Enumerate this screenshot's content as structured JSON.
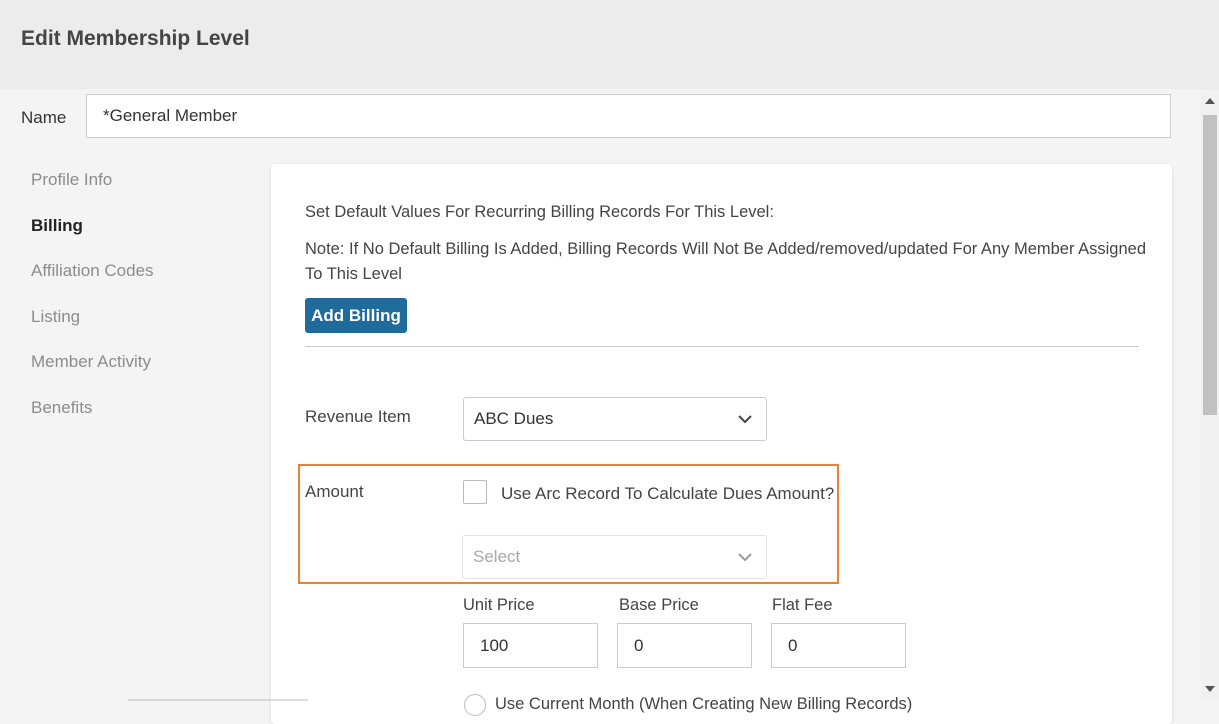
{
  "header": {
    "title": "Edit Membership Level"
  },
  "name_field": {
    "label": "Name",
    "value": "*General Member"
  },
  "sidebar": {
    "items": [
      {
        "label": "Profile Info",
        "active": false
      },
      {
        "label": "Billing",
        "active": true
      },
      {
        "label": "Affiliation Codes",
        "active": false
      },
      {
        "label": "Listing",
        "active": false
      },
      {
        "label": "Member Activity",
        "active": false
      },
      {
        "label": "Benefits",
        "active": false
      }
    ]
  },
  "billing": {
    "intro": "Set Default Values For Recurring Billing Records For This Level:",
    "note": "Note: If No Default Billing Is Added, Billing Records Will Not Be Added/removed/updated For Any Member Assigned To This Level",
    "add_button_label": "Add Billing",
    "revenue_item": {
      "label": "Revenue Item",
      "value": "ABC Dues"
    },
    "amount": {
      "label": "Amount",
      "checkbox_label": "Use Arc Record To Calculate Dues Amount?",
      "checked": false,
      "select_placeholder": "Select"
    },
    "prices": {
      "unit_price_label": "Unit Price",
      "unit_price_value": "100",
      "base_price_label": "Base Price",
      "base_price_value": "0",
      "flat_fee_label": "Flat Fee",
      "flat_fee_value": "0"
    },
    "radio_partial_label": "Use Current Month (When Creating New Billing Records)"
  },
  "colors": {
    "accent_button": "#1e6b9c",
    "highlight_border": "#e8823a"
  },
  "icons": {
    "dropdown": "chevron-down-icon",
    "scroll_up": "scroll-up-arrow-icon",
    "scroll_down": "scroll-down-arrow-icon"
  }
}
